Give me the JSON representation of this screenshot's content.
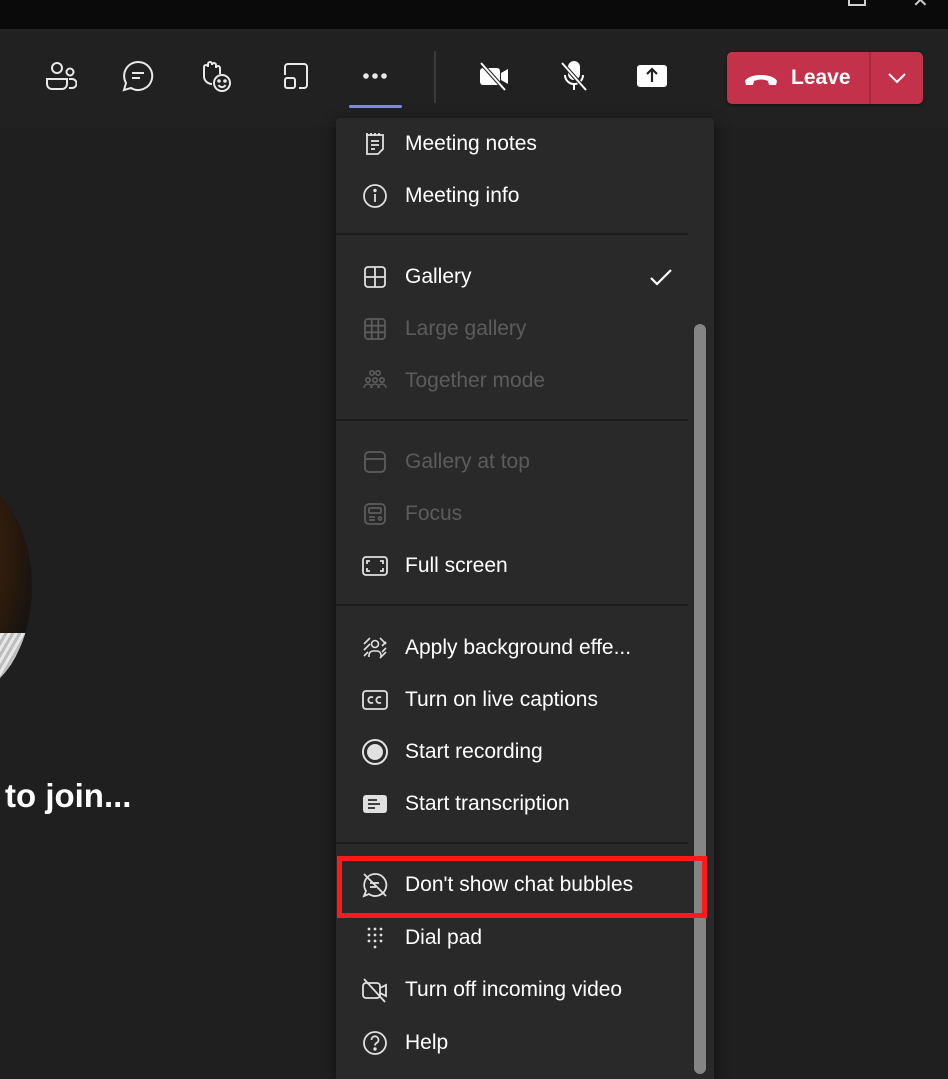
{
  "window": {
    "controls": [
      {
        "name": "maximize",
        "icon": "maximize-icon"
      },
      {
        "name": "close",
        "icon": "close-icon",
        "glyph": "✕"
      }
    ]
  },
  "toolbar": {
    "buttons": [
      {
        "name": "people",
        "icon": "people-icon"
      },
      {
        "name": "chat",
        "icon": "chat-icon"
      },
      {
        "name": "react",
        "icon": "raise-hand-react-icon"
      },
      {
        "name": "rooms",
        "icon": "breakout-rooms-icon"
      },
      {
        "name": "more",
        "icon": "more-actions-icon",
        "active": true
      },
      {
        "name": "camera",
        "icon": "camera-off-icon",
        "state": "off"
      },
      {
        "name": "mic",
        "icon": "mic-off-icon",
        "state": "muted"
      },
      {
        "name": "share",
        "icon": "share-screen-icon"
      }
    ],
    "leave": {
      "label": "Leave",
      "icon": "phone-hangup-icon",
      "color": "#c4314b"
    },
    "accent_color": "#7f85f5"
  },
  "stage": {
    "status_text": "to join..."
  },
  "more_menu": {
    "sections": [
      {
        "items": [
          {
            "label": "Meeting notes",
            "icon": "meeting-notes-icon",
            "enabled": true
          },
          {
            "label": "Meeting info",
            "icon": "info-icon",
            "enabled": true
          }
        ]
      },
      {
        "items": [
          {
            "label": "Gallery",
            "icon": "gallery-icon",
            "enabled": true,
            "checked": true
          },
          {
            "label": "Large gallery",
            "icon": "large-gallery-icon",
            "enabled": false
          },
          {
            "label": "Together mode",
            "icon": "together-mode-icon",
            "enabled": false
          }
        ]
      },
      {
        "items": [
          {
            "label": "Gallery at top",
            "icon": "gallery-at-top-icon",
            "enabled": false
          },
          {
            "label": "Focus",
            "icon": "focus-icon",
            "enabled": false
          },
          {
            "label": "Full screen",
            "icon": "full-screen-icon",
            "enabled": true
          }
        ]
      },
      {
        "items": [
          {
            "label": "Apply background effe...",
            "icon": "background-effects-icon",
            "enabled": true
          },
          {
            "label": "Turn on live captions",
            "icon": "closed-captions-icon",
            "enabled": true
          },
          {
            "label": "Start recording",
            "icon": "record-icon",
            "enabled": true
          },
          {
            "label": "Start transcription",
            "icon": "transcription-icon",
            "enabled": true
          }
        ]
      },
      {
        "items": [
          {
            "label": "Don't show chat bubbles",
            "icon": "chat-bubbles-off-icon",
            "enabled": true,
            "highlighted": true
          },
          {
            "label": "Dial pad",
            "icon": "dial-pad-icon",
            "enabled": true
          },
          {
            "label": "Turn off incoming video",
            "icon": "incoming-video-off-icon",
            "enabled": true
          },
          {
            "label": "Help",
            "icon": "help-icon",
            "enabled": true
          }
        ]
      }
    ],
    "highlight_color": "#ff1a1a"
  }
}
